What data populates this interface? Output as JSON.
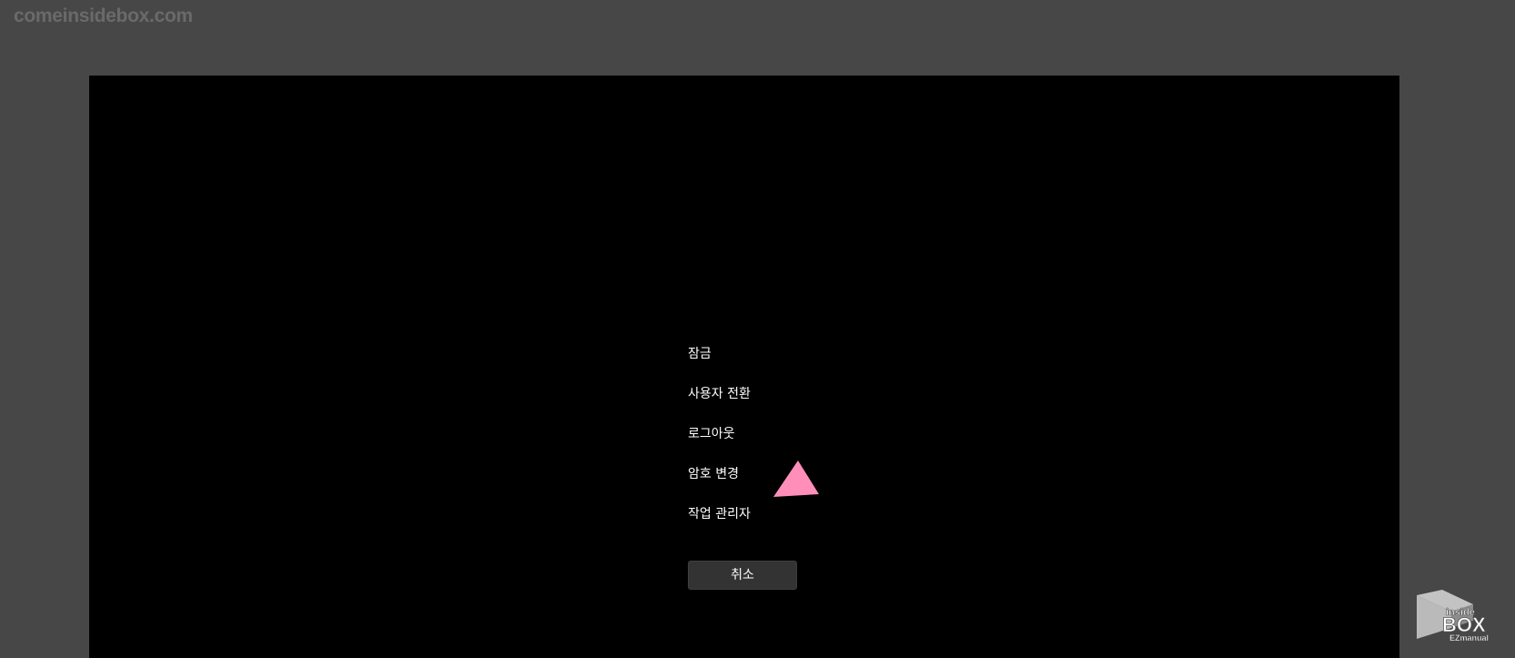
{
  "watermark": {
    "text": "comeinsidebox.com"
  },
  "menu": {
    "items": [
      {
        "label": "잠금"
      },
      {
        "label": "사용자 전환"
      },
      {
        "label": "로그아웃"
      },
      {
        "label": "암호 변경"
      },
      {
        "label": "작업 관리자"
      }
    ]
  },
  "cancel_button": {
    "label": "취소"
  },
  "colors": {
    "outer_background": "#474747",
    "screen_background": "#000000",
    "text": "#ffffff",
    "button_background": "#333333",
    "pointer_arrow": "#ff8fb8",
    "watermark": "#6a6a6a"
  },
  "icons": {
    "pointer": "pink-triangle-arrow-icon",
    "logo": "insidebox-ezmanual-logo"
  },
  "logo": {
    "line1": "inside",
    "line2": "BOX",
    "line3": "EZmanual"
  }
}
